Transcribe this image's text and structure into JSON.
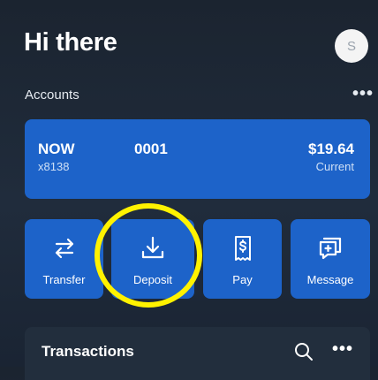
{
  "header": {
    "greeting": "Hi there",
    "avatar_initial": "S"
  },
  "accounts": {
    "label": "Accounts",
    "more_icon": "more-horizontal-icon",
    "card": {
      "name": "NOW",
      "masked_number": "x8138",
      "code": "0001",
      "balance": "$19.64",
      "type": "Current"
    }
  },
  "actions": [
    {
      "label": "Transfer",
      "icon": "transfer-arrows-icon"
    },
    {
      "label": "Deposit",
      "icon": "deposit-download-icon"
    },
    {
      "label": "Pay",
      "icon": "pay-receipt-icon"
    },
    {
      "label": "Message",
      "icon": "message-plus-icon"
    }
  ],
  "transactions": {
    "title": "Transactions",
    "search_icon": "search-icon",
    "more_icon": "more-horizontal-icon"
  },
  "colors": {
    "accent": "#1d63c9",
    "highlight": "#fff200",
    "background": "#1f2a38"
  }
}
